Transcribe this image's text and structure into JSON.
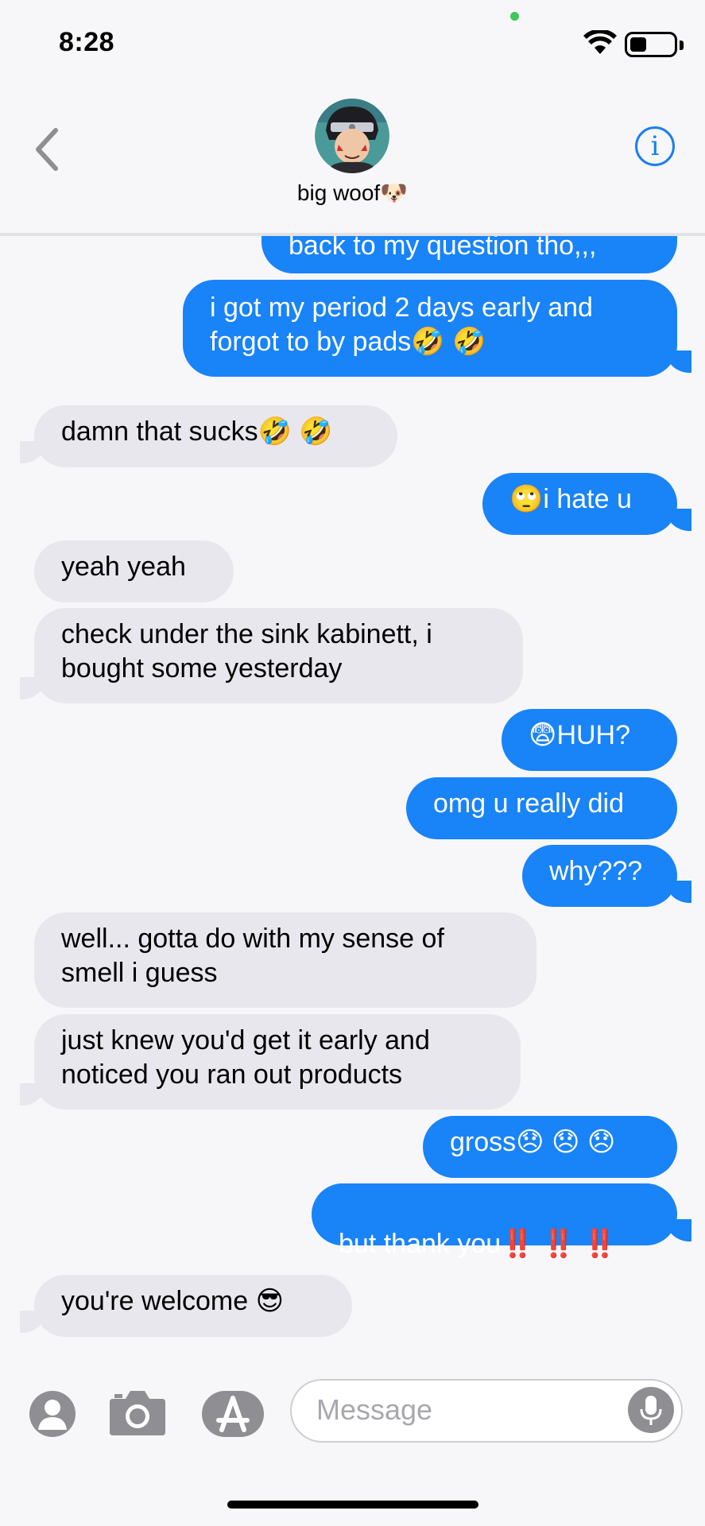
{
  "status": {
    "time": "8:28"
  },
  "header": {
    "contact_name": "big woof🐶",
    "info_glyph": "i"
  },
  "messages": [
    {
      "dir": "sent",
      "text": "back to my question tho,,,"
    },
    {
      "dir": "sent",
      "text": "i got my period 2 days early and forgot to by pads🤣 🤣"
    },
    {
      "dir": "recv",
      "text": "damn that sucks🤣 🤣"
    },
    {
      "dir": "sent",
      "text": "🙄i hate u"
    },
    {
      "dir": "recv",
      "text": "yeah yeah"
    },
    {
      "dir": "recv",
      "text": "check under the sink kabinett, i bought some yesterday"
    },
    {
      "dir": "sent",
      "text": "😨HUH?"
    },
    {
      "dir": "sent",
      "text": "omg u really did"
    },
    {
      "dir": "sent",
      "text": "why???"
    },
    {
      "dir": "recv",
      "text": "well... gotta do with my sense of smell i guess"
    },
    {
      "dir": "recv",
      "text": "just knew you'd get it early and noticed you ran out products"
    },
    {
      "dir": "sent",
      "text": "gross😞 😞 😞"
    },
    {
      "dir": "sent",
      "text": "but thank you",
      "emphasis": "‼️ ‼️ ‼️"
    },
    {
      "dir": "recv",
      "text": "you're welcome 😎"
    }
  ],
  "composer": {
    "placeholder": "Message",
    "icons": [
      "contact-icon",
      "camera-icon",
      "app-store-icon",
      "microphone-icon"
    ]
  },
  "colors": {
    "sent_bubble": "#1983f8",
    "received_bubble": "#e8e7ed",
    "accent": "#1a7ef5"
  }
}
